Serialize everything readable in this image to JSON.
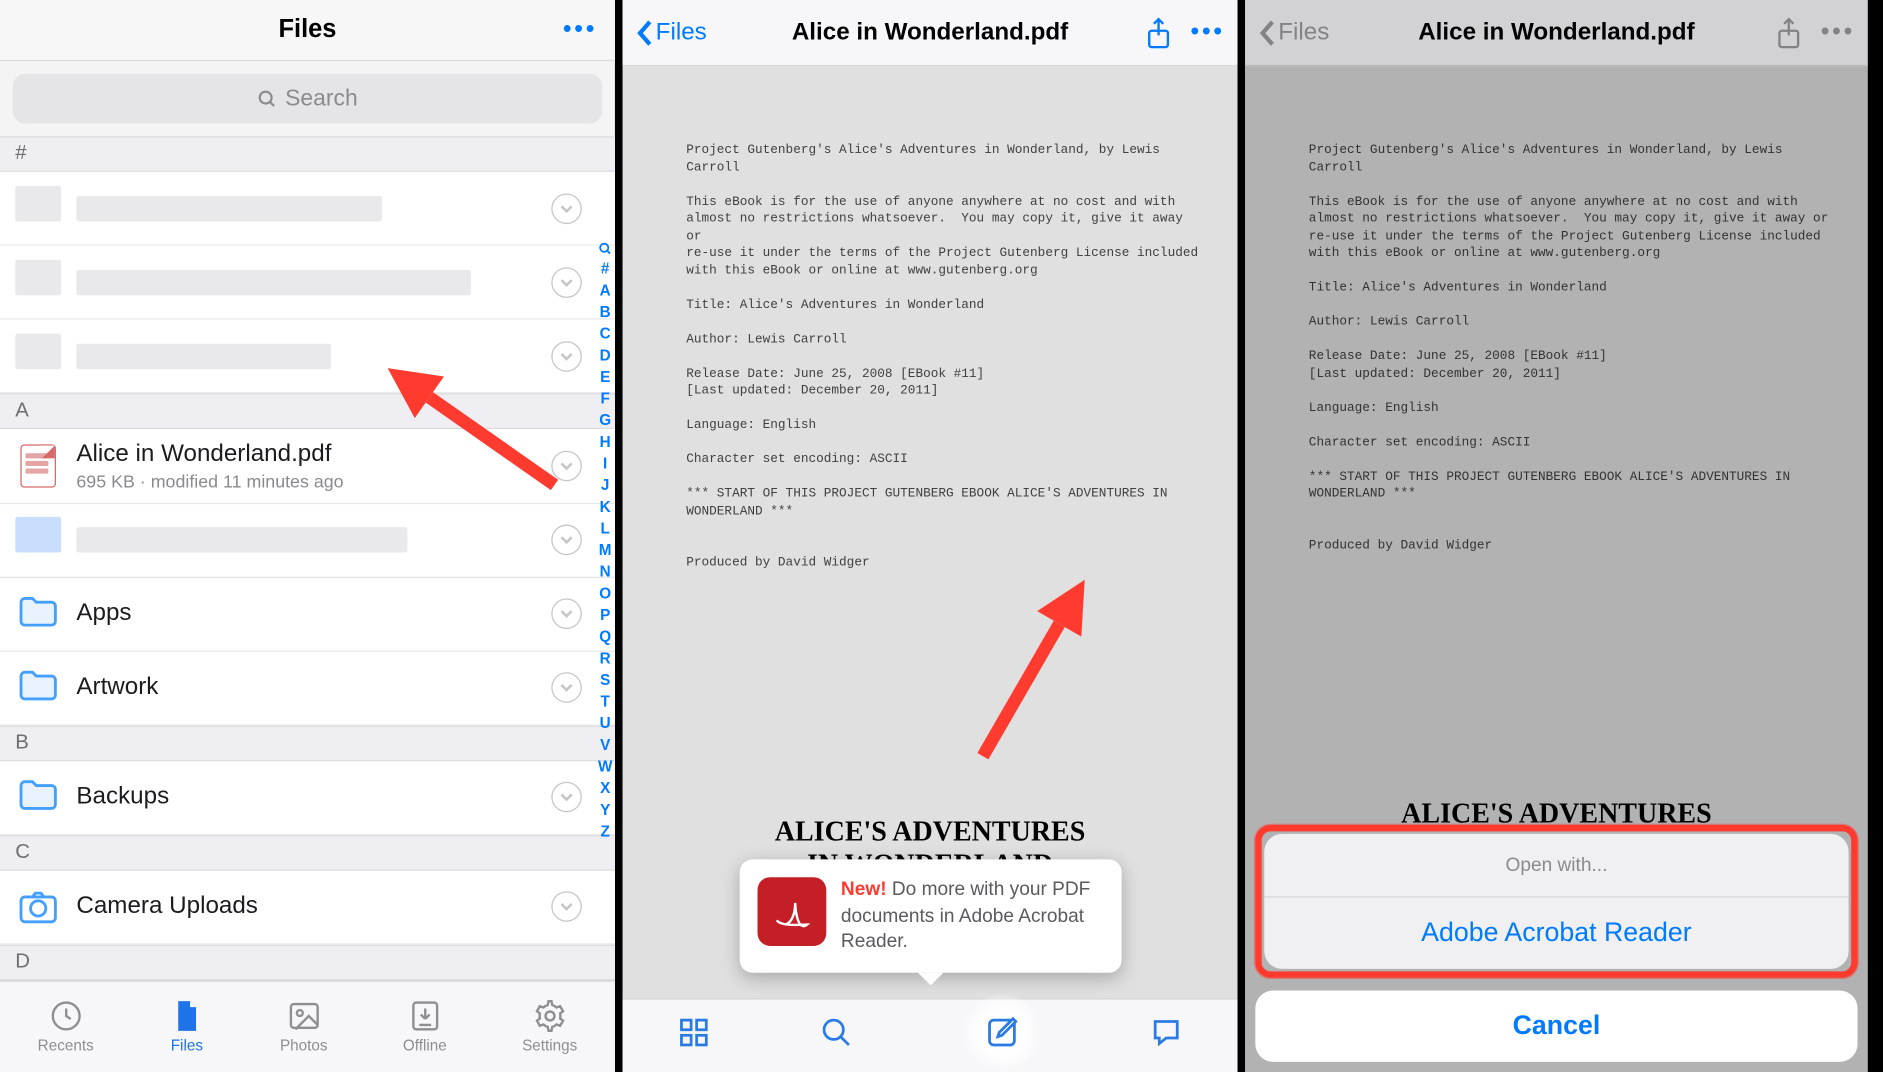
{
  "panel1": {
    "title": "Files",
    "search_placeholder": "Search",
    "section_hash": "#",
    "section_a": "A",
    "section_b": "B",
    "section_c": "C",
    "section_d": "D",
    "file": {
      "name": "Alice in Wonderland.pdf",
      "meta": "695 KB · modified 11 minutes ago"
    },
    "folders": {
      "apps": "Apps",
      "artwork": "Artwork",
      "backups": "Backups",
      "camera": "Camera Uploads"
    },
    "index": [
      "#",
      "A",
      "B",
      "C",
      "D",
      "E",
      "F",
      "G",
      "H",
      "I",
      "J",
      "K",
      "L",
      "M",
      "N",
      "O",
      "P",
      "Q",
      "R",
      "S",
      "T",
      "U",
      "V",
      "W",
      "X",
      "Y",
      "Z"
    ],
    "tabs": {
      "recents": "Recents",
      "files": "Files",
      "photos": "Photos",
      "offline": "Offline",
      "settings": "Settings"
    }
  },
  "preview": {
    "back_label": "Files",
    "title": "Alice in Wonderland.pdf",
    "doc_text": "Project Gutenberg's Alice's Adventures in Wonderland, by Lewis Carroll\n\nThis eBook is for the use of anyone anywhere at no cost and with\nalmost no restrictions whatsoever.  You may copy it, give it away or\nre-use it under the terms of the Project Gutenberg License included\nwith this eBook or online at www.gutenberg.org\n\nTitle: Alice's Adventures in Wonderland\n\nAuthor: Lewis Carroll\n\nRelease Date: June 25, 2008 [EBook #11]\n[Last updated: December 20, 2011]\n\nLanguage: English\n\nCharacter set encoding: ASCII\n\n*** START OF THIS PROJECT GUTENBERG EBOOK ALICE'S ADVENTURES IN WONDERLAND ***\n\n\nProduced by David Widger",
    "doc_title_l1": "ALICE'S ADVENTURES",
    "doc_title_l2": "IN WONDERLAND"
  },
  "tooltip": {
    "new_label": "New!",
    "text": " Do more with your PDF documents in Adobe Acrobat Reader."
  },
  "actionsheet": {
    "open_with": "Open with...",
    "adobe": "Adobe Acrobat Reader",
    "cancel": "Cancel"
  }
}
